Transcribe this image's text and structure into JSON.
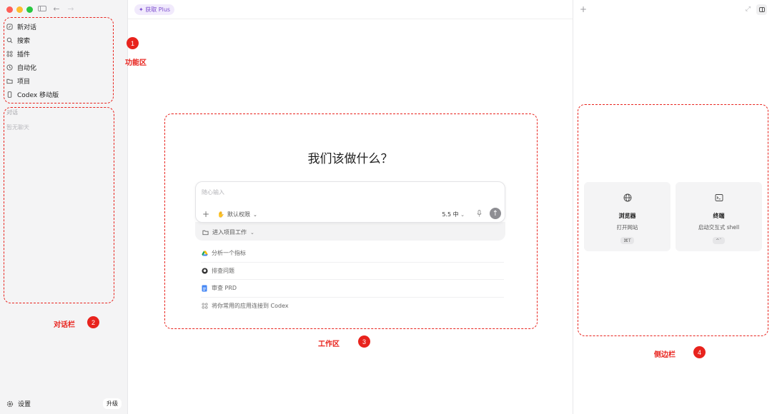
{
  "sidebar": {
    "nav": [
      {
        "label": "新对话",
        "icon": "edit-icon"
      },
      {
        "label": "搜索",
        "icon": "search-icon"
      },
      {
        "label": "插件",
        "icon": "plugins-icon"
      },
      {
        "label": "自动化",
        "icon": "clock-icon"
      },
      {
        "label": "项目",
        "icon": "folder-icon"
      },
      {
        "label": "Codex 移动版",
        "icon": "phone-icon"
      }
    ],
    "section_label": "对话",
    "empty_text": "暂无聊天",
    "settings_label": "设置",
    "upgrade_label": "升级"
  },
  "main": {
    "plus_chip": "✦ 获取 Plus",
    "headline": "我们该做什么？",
    "composer": {
      "placeholder": "随心输入",
      "permission": "默认权限",
      "model": "5.5 中",
      "project": "进入项目工作"
    },
    "suggestions": [
      {
        "label": "分析一个指标",
        "icon": "drive-icon"
      },
      {
        "label": "排查问题",
        "icon": "github-icon"
      },
      {
        "label": "审查 PRD",
        "icon": "doc-icon"
      },
      {
        "label": "将你常用的应用连接到 Codex",
        "icon": "plugins-icon"
      }
    ]
  },
  "right_panel": {
    "cards": [
      {
        "title": "浏览器",
        "subtitle": "打开网站",
        "shortcut": "⌘T",
        "icon": "globe-icon"
      },
      {
        "title": "终端",
        "subtitle": "启动交互式 shell",
        "shortcut": "^`",
        "icon": "terminal-icon"
      }
    ]
  },
  "annotations": [
    {
      "num": "1",
      "label": "功能区"
    },
    {
      "num": "2",
      "label": "对话栏"
    },
    {
      "num": "3",
      "label": "工作区"
    },
    {
      "num": "4",
      "label": "侧边栏"
    }
  ],
  "colors": {
    "annotation": "#e8231d",
    "accent_purple": "#7c4dcf"
  }
}
